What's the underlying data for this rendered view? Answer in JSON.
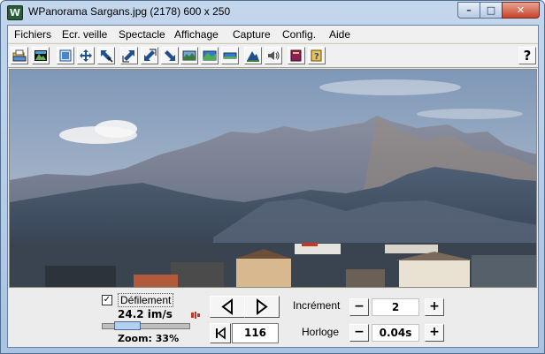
{
  "window": {
    "title": "WPanorama  Sargans.jpg   (2178) 600 x 250",
    "app_icon_glyph": "W",
    "controls": {
      "minimize": "–",
      "maximize": "□",
      "close": "✕"
    }
  },
  "menu": {
    "items": [
      {
        "label": "Fichiers"
      },
      {
        "label": "Ecr. veille"
      },
      {
        "label": "Spectacle"
      },
      {
        "label": "Affichage"
      },
      {
        "label": "Capture"
      },
      {
        "label": "Config."
      },
      {
        "label": "Aide"
      }
    ]
  },
  "toolbar": {
    "buttons": [
      {
        "icon": "open-folder-icon"
      },
      {
        "icon": "picture-icon"
      },
      {
        "icon": "fit-window-icon"
      },
      {
        "icon": "move-icon"
      },
      {
        "icon": "zoom-out-icon"
      },
      {
        "icon": "expand-ne-icon"
      },
      {
        "icon": "shrink-sw-icon"
      },
      {
        "icon": "expand-se-icon"
      },
      {
        "icon": "panorama-icon"
      },
      {
        "icon": "panorama-color-icon"
      },
      {
        "icon": "panorama-flat-icon"
      },
      {
        "icon": "mountain-icon"
      },
      {
        "icon": "sound-icon"
      },
      {
        "icon": "book-icon"
      },
      {
        "icon": "help-book-icon"
      }
    ],
    "help_label": "?"
  },
  "controls": {
    "scroll_enabled": true,
    "scroll_label": "Défilement",
    "speed": "24.2 im/s",
    "zoom": "Zoom: 33%",
    "zoom_fraction": 0.33,
    "frame_number": "116",
    "increment_label": "Incrément",
    "increment_value": "2",
    "clock_label": "Horloge",
    "clock_value": "0.04s",
    "minus": "−",
    "plus": "+",
    "check_mark": "✓"
  },
  "colors": {
    "sky_top": "#7f98b8",
    "sky_bottom": "#b9c5d3",
    "mountain_far": "#6d7a92",
    "mountain_near": "#3f5064",
    "close_button": "#c7432a"
  }
}
